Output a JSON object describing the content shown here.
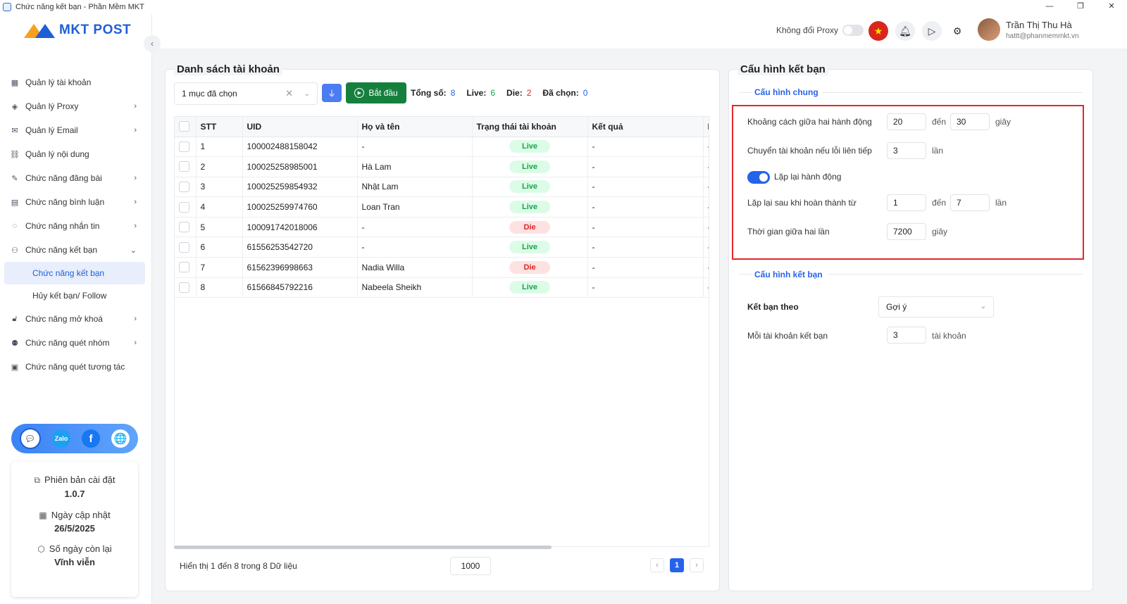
{
  "window": {
    "title": "Chức năng kết bạn - Phần Mềm MKT",
    "minimize": "—",
    "restore": "❐",
    "close": "✕"
  },
  "logo": {
    "text": "MKT POST"
  },
  "sidebar": {
    "items": [
      {
        "label": "Quản lý tài khoản",
        "icon": "grid-icon",
        "chevron": ""
      },
      {
        "label": "Quản lý Proxy",
        "icon": "layers-icon",
        "chevron": "›"
      },
      {
        "label": "Quản lý Email",
        "icon": "mail-icon",
        "chevron": "›"
      },
      {
        "label": "Quản lý nội dung",
        "icon": "link-icon",
        "chevron": ""
      },
      {
        "label": "Chức năng đăng bài",
        "icon": "edit-icon",
        "chevron": "›"
      },
      {
        "label": "Chức năng bình luận",
        "icon": "comment-icon",
        "chevron": "›"
      },
      {
        "label": "Chức năng nhắn tin",
        "icon": "chat-icon",
        "chevron": "›"
      },
      {
        "label": "Chức năng kết bạn",
        "icon": "add-user-icon",
        "chevron": "⌄"
      }
    ],
    "subitems": [
      {
        "label": "Chức năng kết bạn",
        "active": true
      },
      {
        "label": "Hủy kết bạn/ Follow",
        "active": false
      }
    ],
    "items2": [
      {
        "label": "Chức năng mở khoá",
        "icon": "lock-icon",
        "chevron": "›"
      },
      {
        "label": "Chức năng quét nhóm",
        "icon": "group-icon",
        "chevron": "›"
      },
      {
        "label": "Chức năng quét tương tác",
        "icon": "scan-icon",
        "chevron": ""
      }
    ]
  },
  "social": {
    "zalo": "Zalo",
    "facebook": "f",
    "web": "🌐",
    "support": "💬"
  },
  "info": {
    "version_label": "Phiên bản cài đặt",
    "version": "1.0.7",
    "update_label": "Ngày cập nhật",
    "update": "26/5/2025",
    "days_label": "Số ngày còn lại",
    "days": "Vĩnh viễn"
  },
  "header": {
    "proxy_label": "Không đổi Proxy",
    "user_name": "Trần Thị Thu Hà",
    "user_email": "hattt@phanmemmkt.vn"
  },
  "accounts": {
    "title": "Danh sách tài khoản",
    "select_value": "1 mục đã chọn",
    "start_label": "Bắt đầu",
    "stats": {
      "total_label": "Tổng số:",
      "total": "8",
      "live_label": "Live:",
      "live": "6",
      "die_label": "Die:",
      "die": "2",
      "selected_label": "Đã chọn:",
      "selected": "0"
    },
    "columns": [
      "STT",
      "UID",
      "Họ và tên",
      "Trạng thái tài khoản",
      "Kết quả",
      "H"
    ],
    "rows": [
      {
        "stt": "1",
        "uid": "100002488158042",
        "name": "-",
        "status": "Live",
        "result": "-"
      },
      {
        "stt": "2",
        "uid": "100025258985001",
        "name": "Hà Lam",
        "status": "Live",
        "result": "-"
      },
      {
        "stt": "3",
        "uid": "100025259854932",
        "name": "Nhật Lam",
        "status": "Live",
        "result": "-"
      },
      {
        "stt": "4",
        "uid": "100025259974760",
        "name": "Loan Tran",
        "status": "Live",
        "result": "-"
      },
      {
        "stt": "5",
        "uid": "100091742018006",
        "name": "-",
        "status": "Die",
        "result": "-"
      },
      {
        "stt": "6",
        "uid": "61556253542720",
        "name": "-",
        "status": "Live",
        "result": "-"
      },
      {
        "stt": "7",
        "uid": "61562396998663",
        "name": "Nadia Willa",
        "status": "Die",
        "result": "-"
      },
      {
        "stt": "8",
        "uid": "61566845792216",
        "name": "Nabeela Sheikh",
        "status": "Live",
        "result": "-"
      }
    ],
    "footer_text": "Hiển thị 1 đến 8 trong 8 Dữ liệu",
    "page_size": "1000",
    "current_page": "1"
  },
  "config": {
    "title": "Cấu hình kết bạn",
    "general_title": "Cấu hình chung",
    "gap_label": "Khoảng cách giữa hai hành động",
    "gap_from": "20",
    "to_label": "đến",
    "gap_to": "30",
    "second_unit": "giây",
    "switch_label": "Chuyển tài khoản nếu lỗi liên tiếp",
    "switch_value": "3",
    "times_unit": "lần",
    "repeat_label": "Lặp lại hành động",
    "repeat_after_label": "Lặp lại sau khi hoàn thành từ",
    "repeat_from": "1",
    "repeat_to": "7",
    "interval_label": "Thời gian giữa hai lần",
    "interval_value": "7200",
    "friend_title": "Cấu hình kết bạn",
    "friend_by_label": "Kết bạn theo",
    "friend_by_value": "Gợi ý",
    "per_account_label": "Mỗi tài khoản kết bạn",
    "per_account_value": "3",
    "account_unit": "tài khoản"
  }
}
